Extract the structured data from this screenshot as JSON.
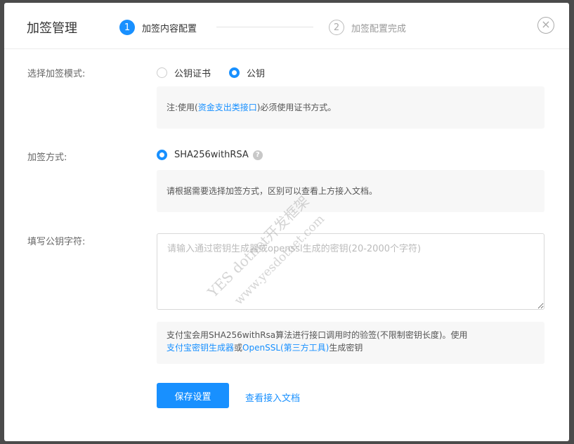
{
  "modal": {
    "title": "加签管理",
    "close_glyph": "×"
  },
  "steps": [
    {
      "num": "1",
      "label": "加签内容配置",
      "state": "active"
    },
    {
      "num": "2",
      "label": "加签配置完成",
      "state": "pending"
    }
  ],
  "mode": {
    "label": "选择加签模式:",
    "options": [
      {
        "label": "公钥证书",
        "checked": false
      },
      {
        "label": "公钥",
        "checked": true
      }
    ],
    "note_prefix": "注:使用(",
    "note_link": "资金支出类接口",
    "note_suffix": ")必须使用证书方式。"
  },
  "method": {
    "label": "加签方式:",
    "option": "SHA256withRSA",
    "help_glyph": "?",
    "note": "请根据需要选择加签方式，区别可以查看上方接入文档。"
  },
  "public_key": {
    "label": "填写公钥字符:",
    "value": "",
    "placeholder": "请输入通过密钥生成器或openssl生成的密钥(20-2000个字符)"
  },
  "info": {
    "text1": "支付宝会用SHA256withRsa算法进行接口调用时的验签(不限制密钥长度)。使用",
    "link1": "支付宝密钥生成器",
    "mid": "或",
    "link2": "OpenSSL(第三方工具)",
    "text2": "生成密钥"
  },
  "actions": {
    "save_label": "保存设置",
    "doc_link": "查看接入文档"
  },
  "watermark": {
    "line1": "YES dotnet开发框架",
    "line2": "www.yesdotnet.com"
  },
  "colors": {
    "primary": "#1890ff",
    "overlay": "#4b4b4b"
  }
}
